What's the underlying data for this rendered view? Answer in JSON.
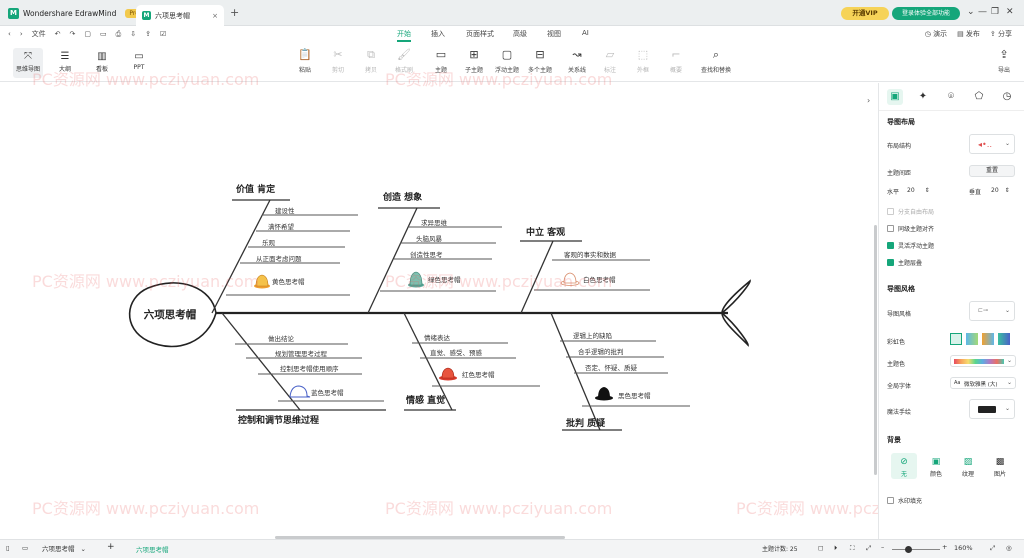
{
  "titlebar": {
    "app_name": "Wondershare EdrawMind",
    "pro_badge": "Pro",
    "doc_tab": "六项思考帽",
    "close_glyph": "×",
    "new_tab": "+",
    "vip_button": "开通VIP",
    "login_button": "登录体验全部功能",
    "window_controls": [
      "⌄",
      "—",
      "❐",
      "✕"
    ]
  },
  "menubar": {
    "file": "文件",
    "tabs": [
      "开始",
      "插入",
      "页面样式",
      "高级",
      "视图",
      "AI"
    ],
    "active_tab": "开始",
    "right": [
      "演示",
      "发布",
      "分享"
    ]
  },
  "ribbon": {
    "views": [
      {
        "label": "思维导图",
        "icon": "⤧"
      },
      {
        "label": "大纲",
        "icon": "☰"
      },
      {
        "label": "看板",
        "icon": "▥"
      },
      {
        "label": "PPT",
        "icon": "▭"
      }
    ],
    "tools": [
      {
        "label": "粘贴",
        "icon": "📋",
        "disabled": false
      },
      {
        "label": "剪切",
        "icon": "✂",
        "disabled": true
      },
      {
        "label": "拷贝",
        "icon": "⧉",
        "disabled": true
      },
      {
        "label": "格式刷",
        "icon": "🖌",
        "disabled": true
      },
      {
        "label": "主题",
        "icon": "▭",
        "disabled": false
      },
      {
        "label": "子主题",
        "icon": "⊞",
        "disabled": false
      },
      {
        "label": "浮动主题",
        "icon": "▢",
        "disabled": false
      },
      {
        "label": "多个主题",
        "icon": "⊟",
        "disabled": false
      },
      {
        "label": "关系线",
        "icon": "↝",
        "disabled": false
      },
      {
        "label": "标注",
        "icon": "▱",
        "disabled": true
      },
      {
        "label": "外框",
        "icon": "⬚",
        "disabled": true
      },
      {
        "label": "概要",
        "icon": "⌐",
        "disabled": true
      },
      {
        "label": "查找和替换",
        "icon": "⌕",
        "disabled": false
      },
      {
        "label": "导出",
        "icon": "⇪",
        "disabled": false
      }
    ]
  },
  "mindmap": {
    "head": "六项思考帽",
    "branches": [
      {
        "title": "价值  肯定",
        "items": [
          "建设性",
          "满怀希望",
          "乐观",
          "从正面考虑问题"
        ],
        "hat": "黄色思考帽",
        "hat_color": "#f0a030"
      },
      {
        "title": "创造  想象",
        "items": [
          "求异思维",
          "头脑风暴",
          "创造性思考"
        ],
        "hat": "绿色思考帽",
        "hat_color": "#5aa89a"
      },
      {
        "title": "中立  客观",
        "items": [
          "客观的事实和数据"
        ],
        "hat": "白色思考帽",
        "hat_color": "#d88c6a"
      },
      {
        "title": "控制和调节思维过程",
        "items": [
          "做出结论",
          "规划管理思考过程",
          "控制思考帽使用顺序"
        ],
        "hat": "蓝色思考帽",
        "hat_color": "#4a62c8"
      },
      {
        "title": "情感  直觉",
        "items": [
          "情绪表达",
          "直觉、感受、预感"
        ],
        "hat": "红色思考帽",
        "hat_color": "#d83a2c"
      },
      {
        "title": "批判  质疑",
        "items": [
          "逻辑上的缺陷",
          "合乎逻辑的批判",
          "否定、怀疑、质疑"
        ],
        "hat": "黑色思考帽",
        "hat_color": "#111111"
      }
    ]
  },
  "watermark": "PC资源网 www.pcziyuan.com",
  "panel": {
    "tabs": [
      "▣",
      "✦",
      "⌾",
      "⬠",
      "◷"
    ],
    "section_layout": "导图布局",
    "layout_struct_label": "布局结构",
    "topic_spacing_label": "主题间距",
    "reset_button": "重置",
    "horizontal_label": "水平",
    "horizontal_value": "20",
    "vertical_label": "垂直",
    "vertical_value": "20",
    "checkboxes": [
      {
        "label": "分支自由布局",
        "checked": false,
        "disabled": true
      },
      {
        "label": "同级主题对齐",
        "checked": false,
        "disabled": false
      },
      {
        "label": "灵活浮动主题",
        "checked": true,
        "disabled": false
      },
      {
        "label": "主题层叠",
        "checked": true,
        "disabled": false
      }
    ],
    "section_style": "导图风格",
    "map_style_label": "导图风格",
    "rainbow_label": "彩虹色",
    "theme_color_label": "主题色",
    "font_label": "全局字体",
    "font_value": "微软雅黑 (大)",
    "font_prefix": "Aa",
    "hand_drawn_label": "魔法手绘",
    "section_bg": "背景",
    "bg_options": [
      {
        "label": "无",
        "icon": "⊘"
      },
      {
        "label": "颜色",
        "icon": "▣"
      },
      {
        "label": "纹理",
        "icon": "▨"
      },
      {
        "label": "图片",
        "icon": "▩"
      }
    ],
    "watermark_check": "水印填充"
  },
  "statusbar": {
    "page_select": "六项思考帽",
    "add": "+",
    "page_tab": "六项思考帽",
    "topic_count": "主题计数: 25",
    "zoom": "160%"
  }
}
